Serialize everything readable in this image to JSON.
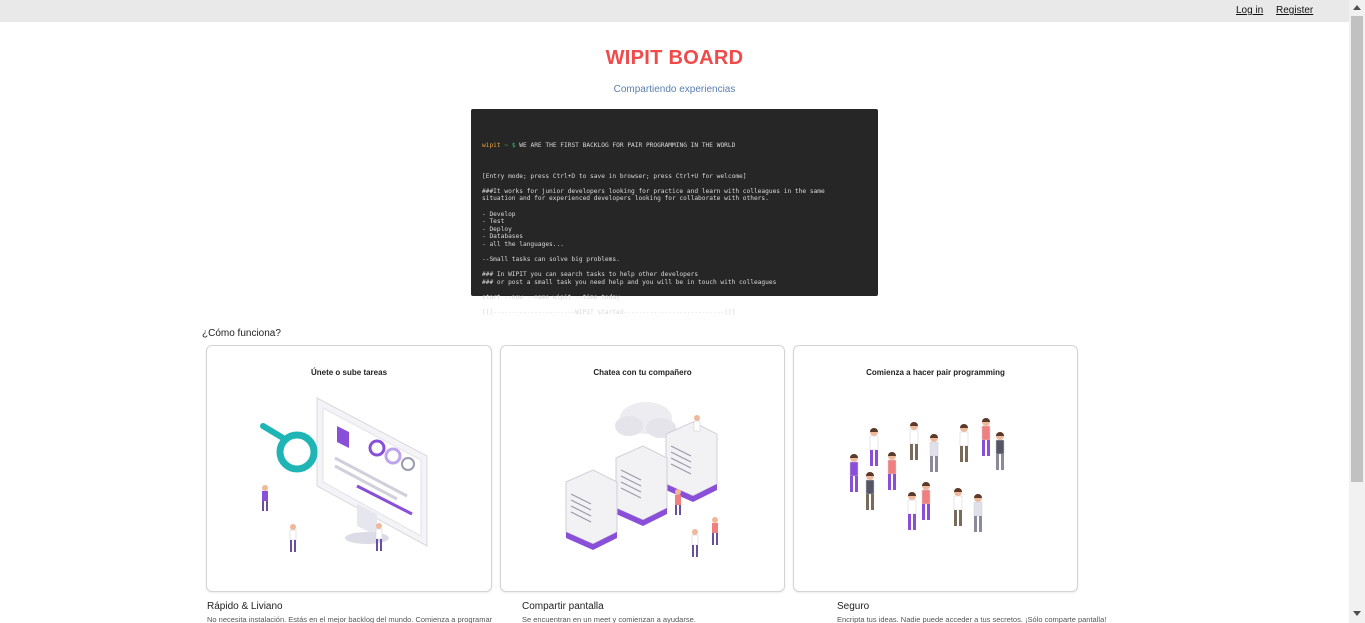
{
  "nav": {
    "login": "Log in",
    "register": "Register"
  },
  "header": {
    "title": "WIPIT BOARD",
    "subtitle": "Compartiendo experiencias"
  },
  "terminal": {
    "prompt_user": "wipit",
    "prompt_sep": "~ $",
    "first_line": "WE ARE THE FIRST BACKLOG FOR PAIR PROGRAMMING IN THE WORLD",
    "lines": [
      "",
      "[Entry mode; press Ctrl+D to save in browser; press Ctrl+U for welcome]",
      "",
      "###It works for junior developers looking for practice and learn with colleagues in the same",
      "situation and for experienced developers looking for collaborate with others.",
      "",
      "- Develop",
      "- Test",
      "- Deploy",
      "- Databases",
      "- all the languages...",
      "",
      "--Small tasks can solve big problems.",
      "",
      "### In WIPIT you can search tasks to help other developers",
      "### or post a small task you need help and you will be in touch with colleagues",
      "",
      "start --now --name wipit --time today",
      "",
      "[[[----------------------WIPIT started---------------------------]]]"
    ]
  },
  "how": {
    "label": "¿Cómo funciona?",
    "cards": [
      {
        "title": "Únete o sube tareas",
        "illustration": "dashboard-magnifier-illustration"
      },
      {
        "title": "Chatea con tu compañero",
        "illustration": "servers-cloud-illustration"
      },
      {
        "title": "Comienza a hacer pair programming",
        "illustration": "people-group-illustration"
      }
    ]
  },
  "features": [
    {
      "title": "Rápido & Liviano",
      "desc": "No necesita instalación. Estás en el mejor backlog del mundo. Comienza a programar"
    },
    {
      "title": "Compartir pantalla",
      "desc": "Se encuentran en un meet y comienzan a ayudarse."
    },
    {
      "title": "Seguro",
      "desc": "Encripta tus ideas. Nadie puede acceder a tus secretos. ¡Sólo comparte pantalla!"
    }
  ],
  "colors": {
    "brand": "#f04a4a",
    "subtitle": "#5a7fb0",
    "accent_purple": "#8a4fd8",
    "accent_teal": "#1fb5b5"
  }
}
